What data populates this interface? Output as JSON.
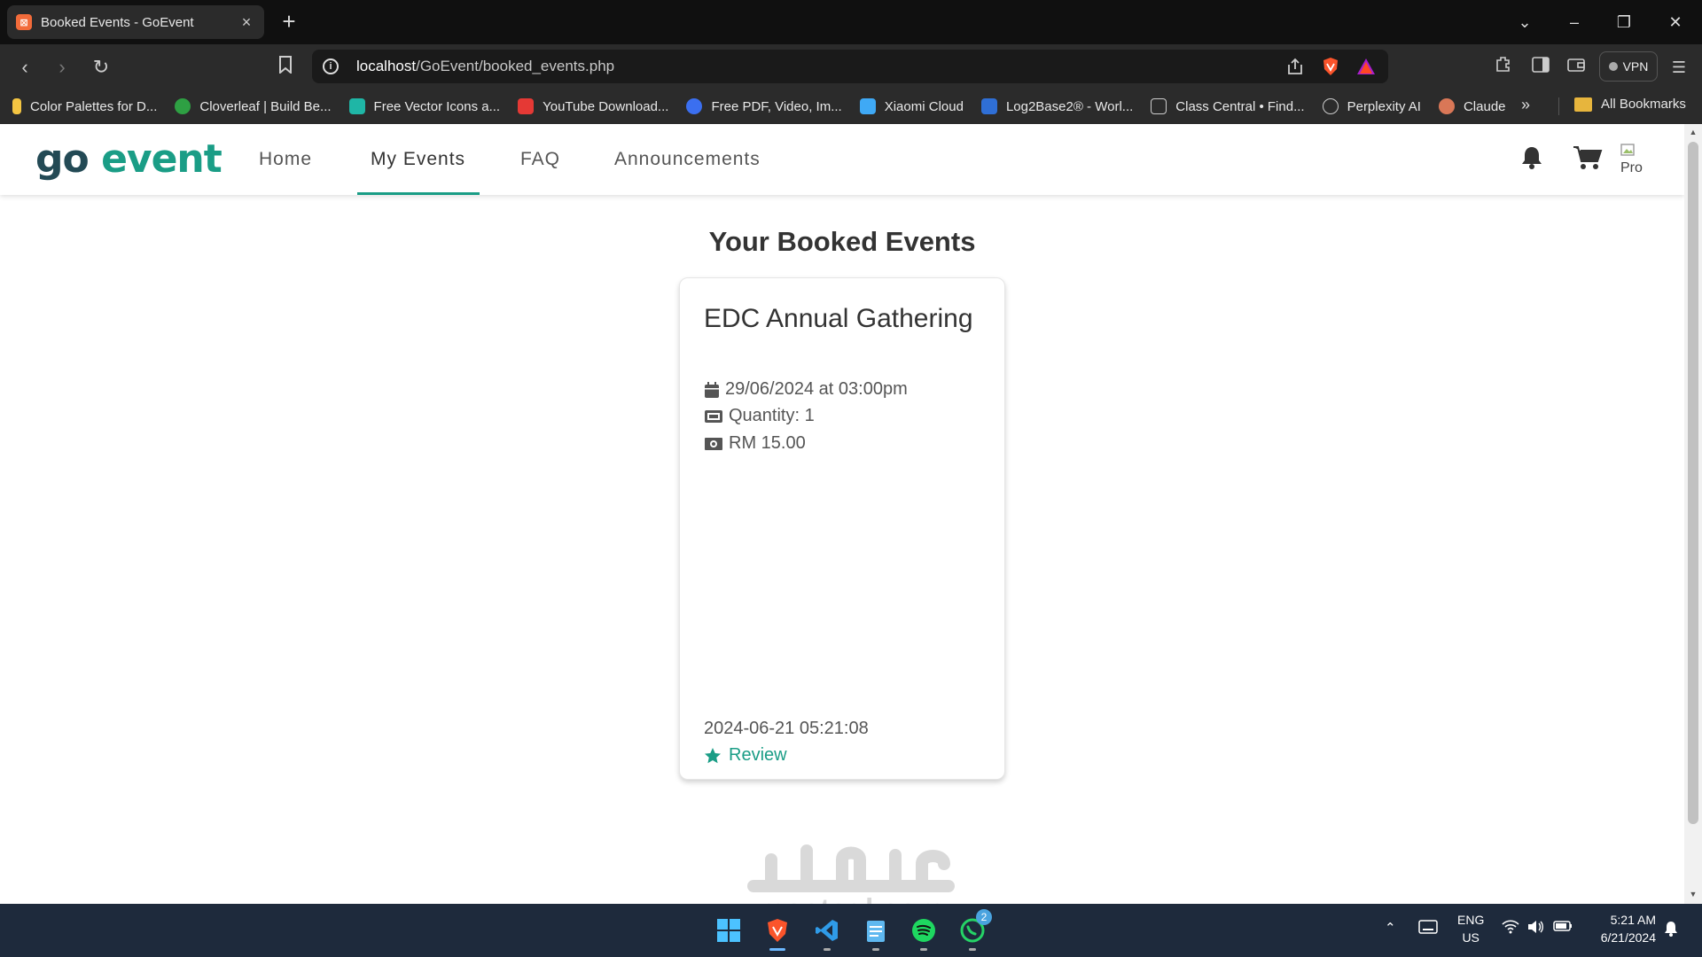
{
  "browser": {
    "tab_title": "Booked Events - GoEvent",
    "url_host": "localhost",
    "url_path": "/GoEvent/booked_events.php",
    "vpn_label": "VPN"
  },
  "bookmarks": [
    {
      "label": "Color Palettes for D...",
      "color": "#f4c542"
    },
    {
      "label": "Cloverleaf | Build Be...",
      "color": "#2ea043"
    },
    {
      "label": "Free Vector Icons a...",
      "color": "#1fb6a6"
    },
    {
      "label": "YouTube Download...",
      "color": "#e53935"
    },
    {
      "label": "Free PDF, Video, Im...",
      "color": "#3b6ff0"
    },
    {
      "label": "Xiaomi Cloud",
      "color": "#3fa9f5"
    },
    {
      "label": "Log2Base2® - Worl...",
      "color": "#2f6fd6"
    },
    {
      "label": "Class Central • Find...",
      "color": "#2b2b2b"
    },
    {
      "label": "Perplexity AI",
      "color": "#2b2b2b"
    },
    {
      "label": "Claude",
      "color": "#d97757"
    }
  ],
  "bookmarks_all": "All Bookmarks",
  "site": {
    "logo_go": "go",
    "logo_event": "event",
    "nav": {
      "home": "Home",
      "my_events": "My Events",
      "faq": "FAQ",
      "announcements": "Announcements"
    },
    "avatar_alt": "Pro",
    "accent": "#1a9d86"
  },
  "page": {
    "heading": "Your Booked Events"
  },
  "booking": {
    "title": "EDC Annual Gathering",
    "date": "29/06/2024 at 03:00pm",
    "quantity": "Quantity: 1",
    "price": "RM 15.00",
    "booked_at": "2024-06-21 05:21:08",
    "review_label": "Review"
  },
  "watermark": {
    "text": "mostaql.com"
  },
  "taskbar": {
    "lang_line1": "ENG",
    "lang_line2": "US",
    "time": "5:21 AM",
    "date": "6/21/2024",
    "whatsapp_badge": "2"
  }
}
